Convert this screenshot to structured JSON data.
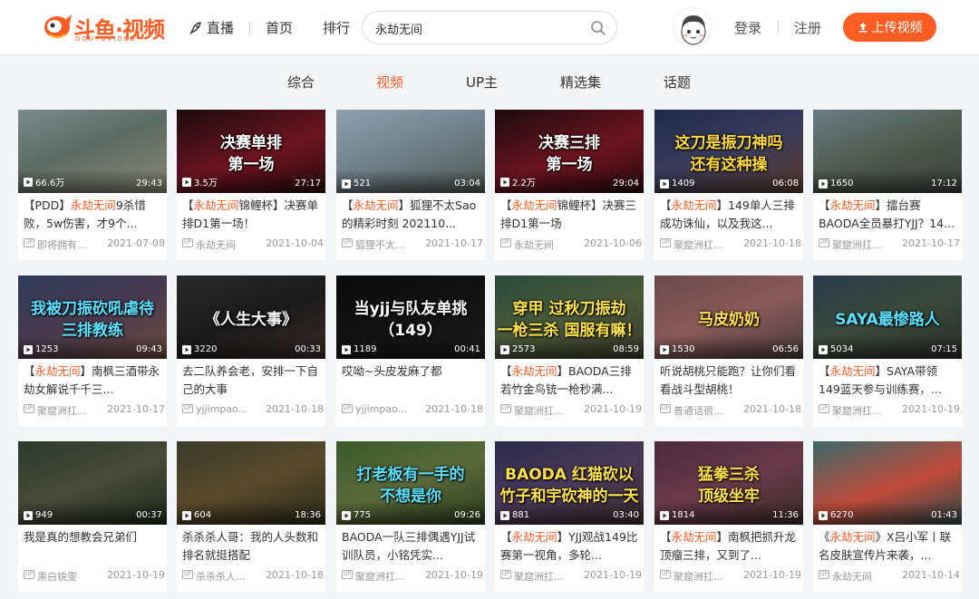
{
  "header": {
    "logo_title": "斗鱼·视频",
    "logo_sub": "DOUYUVIDEO",
    "nav": {
      "live": "直播",
      "home": "首页",
      "rank": "排行"
    },
    "search": {
      "value": "永劫无间"
    },
    "login": "登录",
    "register": "注册",
    "upload": "上传视频"
  },
  "tabs": [
    {
      "label": "综合",
      "active": false
    },
    {
      "label": "视频",
      "active": true
    },
    {
      "label": "UP主",
      "active": false
    },
    {
      "label": "精选集",
      "active": false
    },
    {
      "label": "话题",
      "active": false
    }
  ],
  "colors": {
    "accent": "#ff5d23",
    "keyword": "#ff5d23",
    "meta": "#999999"
  },
  "keyword": "永劫无间",
  "cards": [
    {
      "thumb_bg": "linear-gradient(160deg,#7c8a8a 0%,#5b6b64 45%,#8a8772 100%)",
      "overlay": "",
      "overlay_color": "",
      "views": "66.6万",
      "duration": "29:43",
      "title_pre": "【PDD】",
      "title_kw": "永劫无间",
      "title_post": "9杀惜败，5w伤害，才9个...",
      "author": "即将拥有...",
      "date": "2021-07-08"
    },
    {
      "thumb_bg": "linear-gradient(160deg,#1b0b0e 0%,#6d1420 55%,#2a0a0c 100%)",
      "overlay": "决赛单排\n第一场",
      "overlay_color": "#ffffff",
      "views": "3.5万",
      "duration": "27:17",
      "title_pre": "【",
      "title_kw": "永劫无间",
      "title_post": "锦鲤杯】决赛单排D1第一场！",
      "author": "永劫无间",
      "date": "2021-10-04"
    },
    {
      "thumb_bg": "linear-gradient(160deg,#8fa0ad 0%,#6f7f8a 50%,#4e5a52 100%)",
      "overlay": "",
      "overlay_color": "",
      "views": "521",
      "duration": "03:04",
      "title_pre": "【",
      "title_kw": "永劫无间",
      "title_post": "】狐狸不太Sao的精彩时刻 202110...",
      "author": "狐狸不太...",
      "date": "2021-10-17"
    },
    {
      "thumb_bg": "linear-gradient(160deg,#1b0b0e 0%,#6d1420 55%,#2a0a0c 100%)",
      "overlay": "决赛三排\n第一场",
      "overlay_color": "#ffffff",
      "views": "2.2万",
      "duration": "29:04",
      "title_pre": "【",
      "title_kw": "永劫无间",
      "title_post": "锦鲤杯】决赛三排D1第一场",
      "author": "永劫无间",
      "date": "2021-10-06"
    },
    {
      "thumb_bg": "linear-gradient(160deg,#1d2a4a 0%,#3b3c5c 50%,#5a3a2a 100%)",
      "overlay": "这刀是振刀神吗\n还有这种操",
      "overlay_color": "#ffd83a",
      "views": "1409",
      "duration": "06:08",
      "title_pre": "【",
      "title_kw": "永劫无间",
      "title_post": "】149单人三排成功诛仙，以及我这...",
      "author": "聚窟洲扛...",
      "date": "2021-10-18"
    },
    {
      "thumb_bg": "linear-gradient(160deg,#6b7c86 0%,#4e5b4e 50%,#3a3f38 100%)",
      "overlay": "",
      "overlay_color": "",
      "views": "1650",
      "duration": "17:12",
      "title_pre": "【",
      "title_kw": "永劫无间",
      "title_post": "】擂台赛BAODA全员暴打YJJ？14...",
      "author": "聚窟洲扛...",
      "date": "2021-10-17"
    },
    {
      "thumb_bg": "linear-gradient(160deg,#2d3a5a 0%,#4a3a50 50%,#6a4a3a 100%)",
      "overlay": "我被刀振砍吼虐待\n三排教练",
      "overlay_color": "#5ae0ff",
      "views": "1253",
      "duration": "09:43",
      "title_pre": "【",
      "title_kw": "永劫无间",
      "title_post": "】南枫三酒带永劫女解说千千三...",
      "author": "聚窟洲扛...",
      "date": "2021-10-17"
    },
    {
      "thumb_bg": "linear-gradient(160deg,#2a2a2a 0%,#1a1a1a 50%,#3a2a2a 100%)",
      "overlay": "《人生大事》",
      "overlay_color": "#ffffff",
      "views": "3220",
      "duration": "00:33",
      "title_pre": "去二队养会老，安排一下自己的大事",
      "title_kw": "",
      "title_post": "",
      "author": "yjjimpao...",
      "date": "2021-10-18"
    },
    {
      "thumb_bg": "linear-gradient(160deg,#0a0a0a 0%,#1a1a1a 100%)",
      "overlay": "当yjj与队友单挑\n（149）",
      "overlay_color": "#ffffff",
      "views": "1189",
      "duration": "00:41",
      "title_pre": "哎呦~头皮发麻了都",
      "title_kw": "",
      "title_post": "",
      "author": "yjjimpao...",
      "date": "2021-10-18"
    },
    {
      "thumb_bg": "linear-gradient(160deg,#2a4a3a 0%,#4a5a3a 50%,#3a3a2a 100%)",
      "overlay": "穿甲 过秋刀振劫\n一枪三杀 国服有嘛！",
      "overlay_color": "#ffe14a",
      "views": "2573",
      "duration": "08:59",
      "title_pre": "【",
      "title_kw": "永劫无间",
      "title_post": "】BAODA三排若竹金鸟铳一枪秒满...",
      "author": "聚窟洲扛...",
      "date": "2021-10-19"
    },
    {
      "thumb_bg": "linear-gradient(160deg,#6a4a4a 0%,#8a5a5a 50%,#4a3a3a 100%)",
      "overlay": "马皮奶奶",
      "overlay_color": "#ffe14a",
      "views": "1530",
      "duration": "06:56",
      "title_pre": "听说胡桃只能跑？让你们看看战斗型胡桃！",
      "title_kw": "",
      "title_post": "",
      "author": "普通话很...",
      "date": "2021-10-18"
    },
    {
      "thumb_bg": "linear-gradient(160deg,#2a3a4a 0%,#3a4a3a 50%,#2a2a2a 100%)",
      "overlay": "SAYA最惨路人",
      "overlay_color": "#5ae0ff",
      "views": "5034",
      "duration": "07:15",
      "title_pre": "【",
      "title_kw": "永劫无间",
      "title_post": "】SAYA带领149蓝天参与训练赛，...",
      "author": "聚窟洲扛...",
      "date": "2021-10-19"
    },
    {
      "thumb_bg": "linear-gradient(160deg,#2a3a2a 0%,#4a4a3a 50%,#1a2a1a 100%)",
      "overlay": "",
      "overlay_color": "",
      "views": "949",
      "duration": "00:37",
      "title_pre": "我是真的想教会兄弟们",
      "title_kw": "",
      "title_post": "",
      "author": "黑白锐雯",
      "date": "2021-10-19"
    },
    {
      "thumb_bg": "linear-gradient(160deg,#3a3a2a 0%,#5a4a2a 50%,#2a2a1a 100%)",
      "overlay": "",
      "overlay_color": "",
      "views": "604",
      "duration": "18:36",
      "title_pre": "杀杀杀人哥：我的人头数和排名就挺搭配",
      "title_kw": "",
      "title_post": "",
      "author": "杀杀杀人...",
      "date": "2021-10-18"
    },
    {
      "thumb_bg": "linear-gradient(160deg,#3a5a2a 0%,#5a6a3a 50%,#2a3a1a 100%)",
      "overlay": "打老板有一手的\n不想是你",
      "overlay_color": "#5ae0ff",
      "views": "775",
      "duration": "09:26",
      "title_pre": "BAODA一队三排偶遇YJJ试训队员，小铭凭实...",
      "title_kw": "",
      "title_post": "",
      "author": "聚窟洲扛...",
      "date": "2021-10-19"
    },
    {
      "thumb_bg": "linear-gradient(160deg,#2a2a4a 0%,#4a3a5a 50%,#3a2a2a 100%)",
      "overlay": "BAODA 红猫砍以\n竹子和宇砍神的一天",
      "overlay_color": "#ffe14a",
      "views": "881",
      "duration": "03:40",
      "title_pre": "【",
      "title_kw": "永劫无间",
      "title_post": "】YJJ观战149比赛第一视角，多轮...",
      "author": "聚窟洲扛...",
      "date": "2021-10-19"
    },
    {
      "thumb_bg": "linear-gradient(160deg,#4a2a3a 0%,#6a3a4a 50%,#3a2a2a 100%)",
      "overlay": "猛拳三杀\n顶级坐牢",
      "overlay_color": "#ffe14a",
      "views": "1814",
      "duration": "11:36",
      "title_pre": "【",
      "title_kw": "永劫无间",
      "title_post": "】南枫把抓升龙顶瘤三排，又到了...",
      "author": "聚窟洲扛...",
      "date": "2021-10-19"
    },
    {
      "thumb_bg": "linear-gradient(160deg,#3a6a6a 0%,#c04a3a 55%,#2a4a4a 100%)",
      "overlay": "",
      "overlay_color": "",
      "views": "6270",
      "duration": "01:43",
      "title_pre": "《",
      "title_kw": "永劫无间",
      "title_post": "》X吕小军丨联名皮肤宣传片来袭，...",
      "author": "永劫无间",
      "date": "2021-10-14"
    }
  ]
}
